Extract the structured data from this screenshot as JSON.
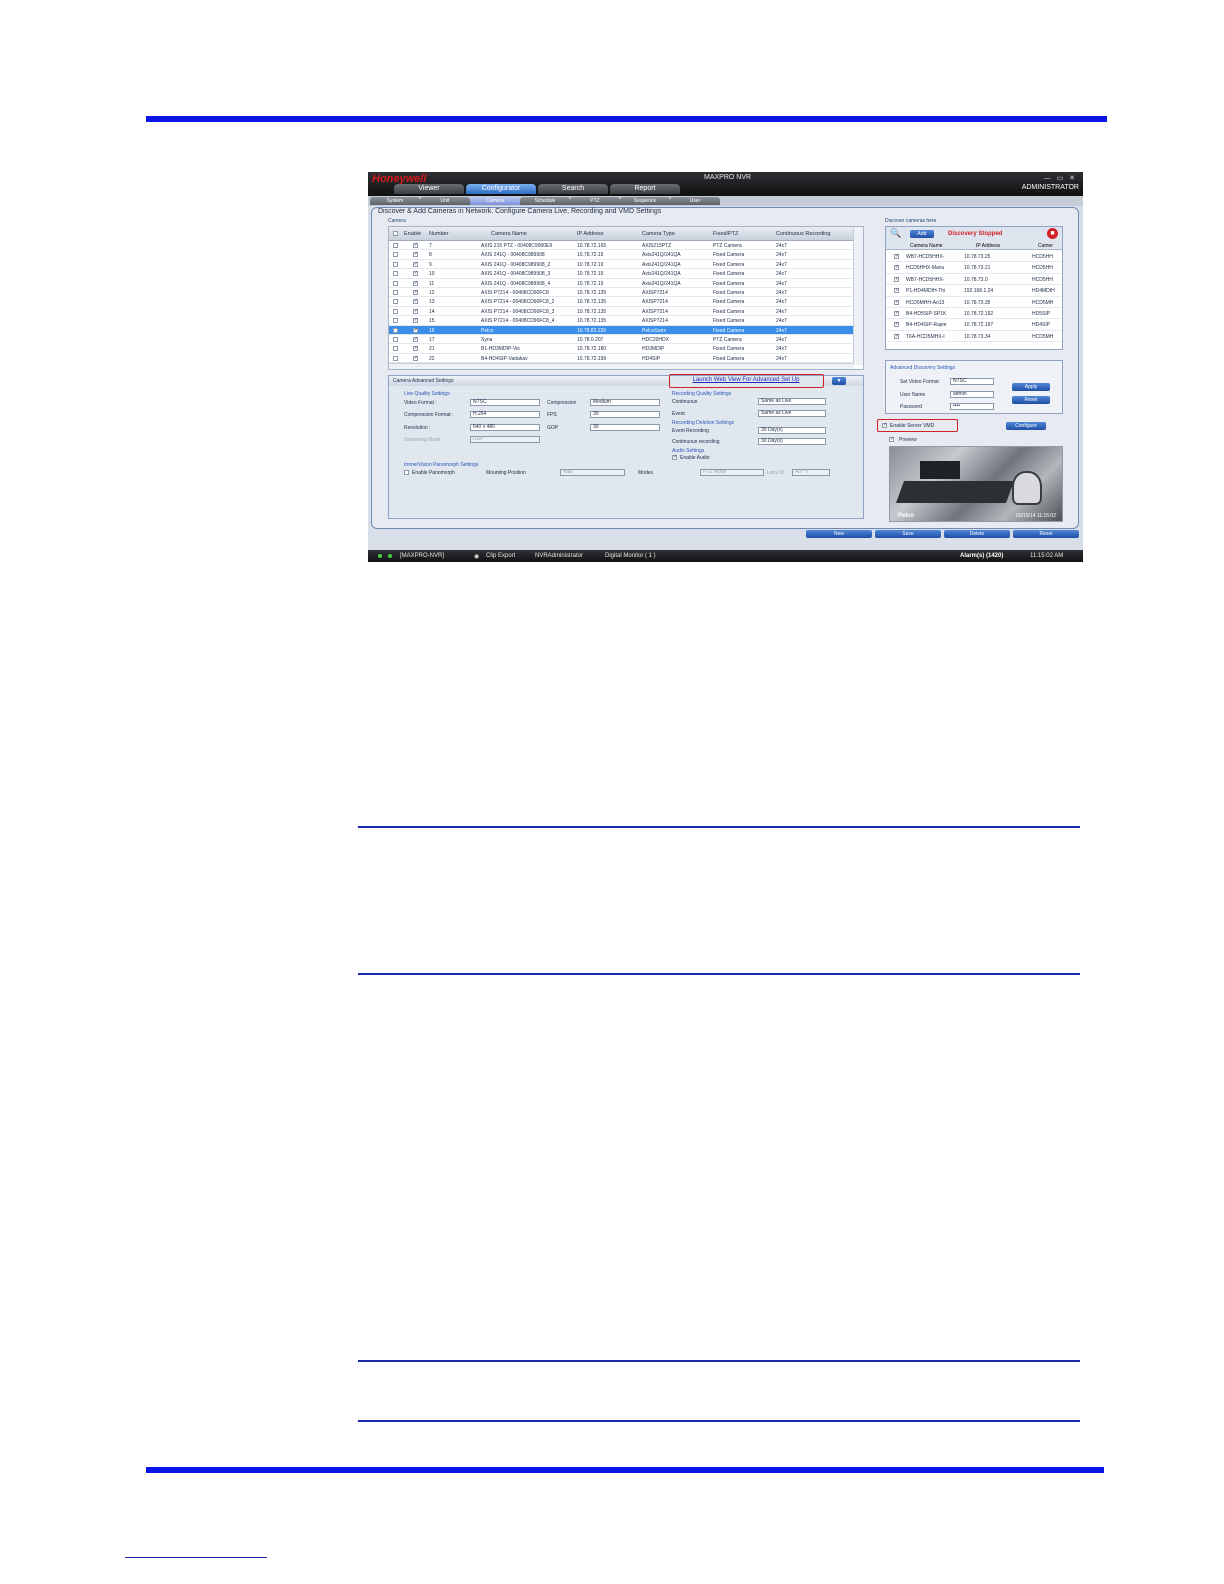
{
  "app": {
    "brand": "Honeywell",
    "title": "MAXPRO NVR",
    "window_controls": "— ▭ ✕",
    "user": "ADMINISTRATOR"
  },
  "main_tabs": [
    {
      "label": "Viewer",
      "active": false
    },
    {
      "label": "Configurator",
      "active": true
    },
    {
      "label": "Search",
      "active": false
    },
    {
      "label": "Report",
      "active": false
    }
  ],
  "sub_tabs": [
    {
      "label": "System",
      "active": false
    },
    {
      "label": "Unit",
      "active": false
    },
    {
      "label": "Camera",
      "active": true
    },
    {
      "label": "Schedule",
      "active": false
    },
    {
      "label": "PTZ",
      "active": false
    },
    {
      "label": "Sequence",
      "active": false
    },
    {
      "label": "User",
      "active": false
    }
  ],
  "panel": {
    "title": "Discover & Add Cameras in Network. Configure Camera Live, Recording and VMD Settings",
    "cameras_label": "Camera",
    "discover_label": "Discover cameras here"
  },
  "camera_table": {
    "headers": [
      "Enable",
      "Number",
      "Camera Name",
      "IP Address",
      "Camera Type",
      "Fixed/PTZ",
      "Continuous Recording"
    ],
    "rows": [
      {
        "enabled": true,
        "number": "7",
        "name": "AXIS 215 PTZ - 00408C9000E9",
        "ip": "10.78.72.165",
        "type": "AXIS215PTZ",
        "fixed": "PTZ Camera",
        "rec": "24x7",
        "selected": false
      },
      {
        "enabled": true,
        "number": "8",
        "name": "AXIS 241Q - 00408C989908",
        "ip": "10.78.72.19",
        "type": "Axis241Q/241QA",
        "fixed": "Fixed Camera",
        "rec": "24x7",
        "selected": false
      },
      {
        "enabled": true,
        "number": "9",
        "name": "AXIS 241Q - 00408C989908_2",
        "ip": "10.78.72.19",
        "type": "Axis241Q/241QA",
        "fixed": "Fixed Camera",
        "rec": "24x7",
        "selected": false
      },
      {
        "enabled": true,
        "number": "10",
        "name": "AXIS 241Q - 00408C989908_3",
        "ip": "10.78.72.19",
        "type": "Axis241Q/241QA",
        "fixed": "Fixed Camera",
        "rec": "24x7",
        "selected": false
      },
      {
        "enabled": true,
        "number": "11",
        "name": "AXIS 241Q - 00408C989908_4",
        "ip": "10.78.72.19",
        "type": "Axis241Q/241QA",
        "fixed": "Fixed Camera",
        "rec": "24x7",
        "selected": false
      },
      {
        "enabled": true,
        "number": "12",
        "name": "AXIS P7214 - 00408CD90FC8",
        "ip": "10.78.72.135",
        "type": "AXISP7214",
        "fixed": "Fixed Camera",
        "rec": "24x7",
        "selected": false
      },
      {
        "enabled": true,
        "number": "13",
        "name": "AXIS P7214 - 00408CD90FC8_2",
        "ip": "10.78.72.135",
        "type": "AXISP7214",
        "fixed": "Fixed Camera",
        "rec": "24x7",
        "selected": false
      },
      {
        "enabled": true,
        "number": "14",
        "name": "AXIS P7214 - 00408CD90FC8_3",
        "ip": "10.78.72.135",
        "type": "AXISP7214",
        "fixed": "Fixed Camera",
        "rec": "24x7",
        "selected": false
      },
      {
        "enabled": true,
        "number": "15",
        "name": "AXIS P7214 - 00408CD90FC8_4",
        "ip": "10.78.72.135",
        "type": "AXISP7214",
        "fixed": "Fixed Camera",
        "rec": "24x7",
        "selected": false
      },
      {
        "enabled": true,
        "number": "16",
        "name": "Pelco",
        "ip": "10.78.83.220",
        "type": "PelcoSarix",
        "fixed": "Fixed Camera",
        "rec": "24x7",
        "selected": true
      },
      {
        "enabled": true,
        "number": "17",
        "name": "Syna",
        "ip": "10.78.0.207",
        "type": "HDC20HDX",
        "fixed": "PTZ Camera",
        "rec": "24x7",
        "selected": false
      },
      {
        "enabled": true,
        "number": "21",
        "name": "B1-HD3MDIP-Vis",
        "ip": "10.78.72.180",
        "type": "HD3MDIP",
        "fixed": "Fixed Camera",
        "rec": "24x7",
        "selected": false
      },
      {
        "enabled": true,
        "number": "22",
        "name": "B4-HD4SIP-Vadakav",
        "ip": "10.78.72.199",
        "type": "HD4SIP",
        "fixed": "Fixed Camera",
        "rec": "24x7",
        "selected": false
      }
    ]
  },
  "advanced": {
    "title": "Camera Advanced Settings",
    "launch_link": "Launch Web View For Advanced Set Up",
    "live_quality": {
      "label": "Live Quality Settings",
      "video_format_label": "Video Format :",
      "video_format": "NTSC",
      "compression_label": "Compression",
      "compression": "Medium",
      "compression_format_label": "Compression Format :",
      "compression_format": "H.264",
      "fps_label": "FPS",
      "fps": "30",
      "resolution_label": "Resolution :",
      "resolution": "640 x 480",
      "gop_label": "GOP",
      "gop": "30",
      "streaming_label": "Streaming Mode",
      "streaming": "UDP"
    },
    "recording_quality": {
      "label": "Recording Quality Settings",
      "continuous_label": "Continuous",
      "continuous": "Same as Live",
      "event_label": "Event",
      "event": "Same as Live"
    },
    "deletion": {
      "label": "Recording Deletion Settings",
      "event_rec_label": "Event Recording",
      "event_rec": "30 Day(s)",
      "cont_rec_label": "Continuous recording",
      "cont_rec": "30 Day(s)"
    },
    "audio": {
      "label": "Audio Settings",
      "enable_label": "Enable Audio"
    },
    "panomorph": {
      "label": "ImmerVision Panomorph Settings",
      "enable_label": "Enable Panomorph",
      "mounting_label": "Mounting Position",
      "mounting": "Wall",
      "modes_label": "Modes",
      "modes": "PTZ Mode",
      "lens_label": "Lens ID",
      "lens": "A0**V"
    }
  },
  "discover": {
    "add_label": "Add",
    "status": "Discovery Stopped",
    "headers": [
      "Camera Name",
      "IP Address",
      "Camer"
    ],
    "rows": [
      {
        "name": "WB7-HCD5HHX-",
        "ip": "10.78.73.25",
        "type": "HCD5HH"
      },
      {
        "name": "HCD5HHX-Manu",
        "ip": "10.78.73.21",
        "type": "HCD5HH"
      },
      {
        "name": "WB7-HCD5HHX-",
        "ip": "10.78.73.0",
        "type": "HCD5HH"
      },
      {
        "name": "P1-HD4MDIH-Thi",
        "ip": "192.168.1.24",
        "type": "HD4MDIH"
      },
      {
        "name": "HCD5MHH-Ao13",
        "ip": "10.78.73.35",
        "type": "HCD5MH"
      },
      {
        "name": "B4-HD5SIP-SP1K",
        "ip": "10.78.72.192",
        "type": "HD5SIP"
      },
      {
        "name": "B4-HD4SIP-Rajee",
        "ip": "10.78.72.197",
        "type": "HD4SIP"
      },
      {
        "name": "T6A-HCD5MHX-I",
        "ip": "10.78.73.34",
        "type": "HCD5MH"
      }
    ]
  },
  "adv_discovery": {
    "title": "Advanced Discovery Settings",
    "video_format_label": "Set Video Format",
    "video_format": "NTSC",
    "user_label": "User Name",
    "user": "admin",
    "password_label": "Password",
    "password": "••••",
    "apply": "Apply",
    "reset": "Reset"
  },
  "vmd": {
    "enable_label": "Enable Server VMD",
    "configure": "Configure",
    "preview_label": "Preview",
    "preview_brand": "Pelco",
    "preview_time": "05/10/14 11:15:02"
  },
  "bottom_buttons": [
    "New",
    "Save",
    "Delete",
    "Reset"
  ],
  "status": {
    "server": "[MAXPRO-NVR]",
    "clip": "Clip Export",
    "user": "NVRAdministrator",
    "monitor": "Digital Monitor ( 1 )",
    "alarms": "Alarm(s) (1420)",
    "time": "11:15:02 AM"
  },
  "colors": {
    "rule_blue": "#0a14e6",
    "selection_blue": "#3a8de8",
    "highlight_red": "#d32026"
  }
}
